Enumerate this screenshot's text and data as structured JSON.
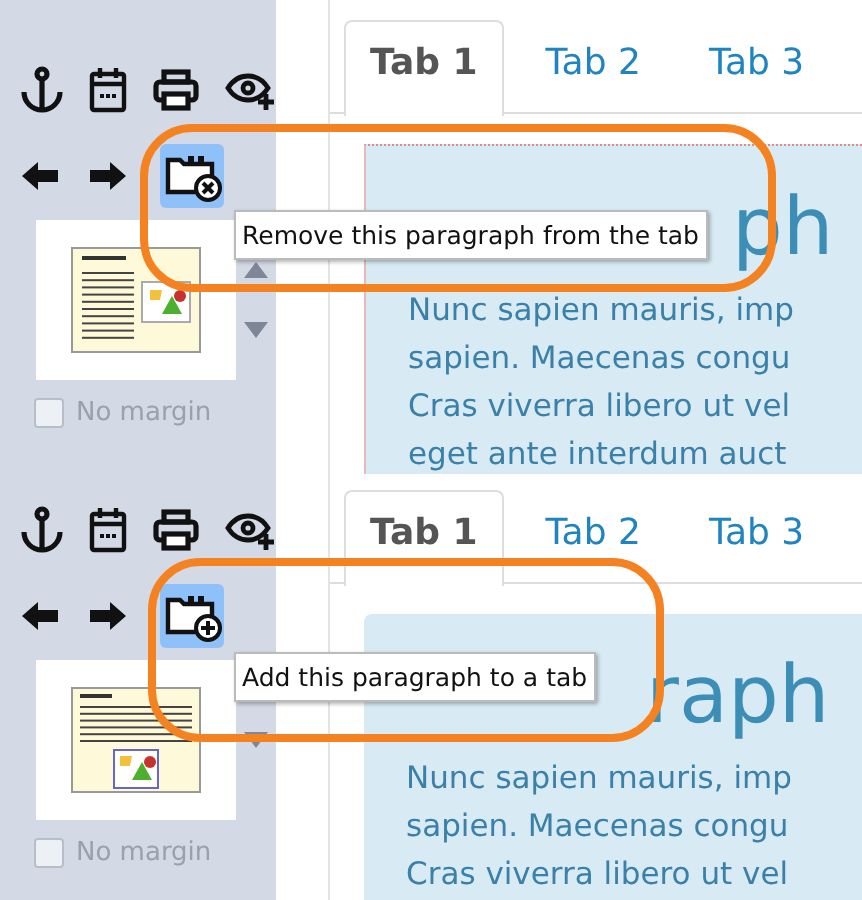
{
  "panels": [
    {
      "action_button": {
        "kind": "remove",
        "active": true
      },
      "tooltip": "Remove this paragraph from the tab",
      "thumbnail": {
        "kind": "image-right",
        "scroll_up": true
      },
      "checkbox": {
        "label": "No margin",
        "checked": false
      },
      "tabs": [
        {
          "label": "Tab 1",
          "selected": true
        },
        {
          "label": "Tab 2",
          "selected": false
        },
        {
          "label": "Tab 3",
          "selected": false
        }
      ],
      "heading": "ph",
      "lines": [
        "Nunc sapien mauris, imp",
        "sapien. Maecenas congu",
        "Cras viverra libero ut vel",
        "eget ante interdum auct"
      ]
    },
    {
      "action_button": {
        "kind": "add",
        "active": true
      },
      "tooltip": "Add this paragraph to a tab",
      "thumbnail": {
        "kind": "image-below",
        "scroll_up": false
      },
      "checkbox": {
        "label": "No margin",
        "checked": false
      },
      "tabs": [
        {
          "label": "Tab 1",
          "selected": true
        },
        {
          "label": "Tab 2",
          "selected": false
        },
        {
          "label": "Tab 3",
          "selected": false
        }
      ],
      "heading": "raph",
      "lines": [
        "Nunc sapien mauris, imp",
        "sapien. Maecenas congu",
        "Cras viverra libero ut vel"
      ]
    }
  ]
}
